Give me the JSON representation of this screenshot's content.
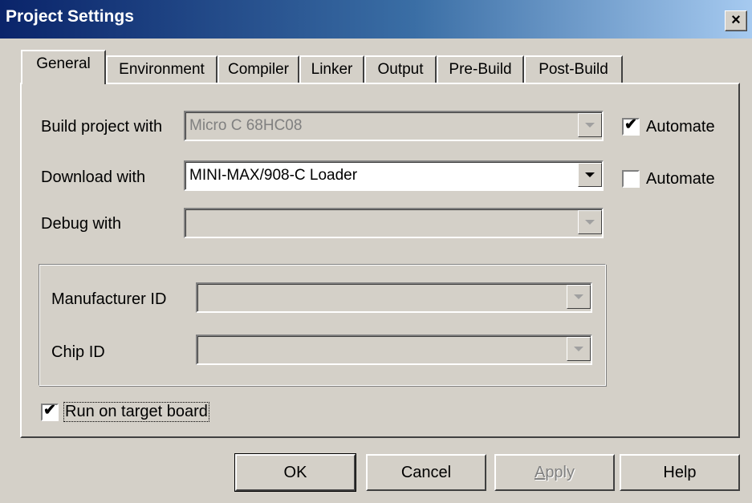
{
  "window": {
    "title": "Project Settings",
    "close_glyph": "×"
  },
  "tabs": [
    {
      "label": "General",
      "active": true
    },
    {
      "label": "Environment",
      "active": false
    },
    {
      "label": "Compiler",
      "active": false
    },
    {
      "label": "Linker",
      "active": false
    },
    {
      "label": "Output",
      "active": false
    },
    {
      "label": "Pre-Build",
      "active": false
    },
    {
      "label": "Post-Build",
      "active": false
    }
  ],
  "general": {
    "build": {
      "label": "Build project with",
      "value": "Micro C 68HC08",
      "enabled": false,
      "automate_label": "Automate",
      "automate_checked": true
    },
    "download": {
      "label": "Download with",
      "value": "MINI-MAX/908-C Loader",
      "enabled": true,
      "automate_label": "Automate",
      "automate_checked": false
    },
    "debug": {
      "label": "Debug with",
      "value": "",
      "enabled": false
    },
    "manufacturer": {
      "label": "Manufacturer ID",
      "value": "",
      "enabled": false
    },
    "chip": {
      "label": "Chip ID",
      "value": "",
      "enabled": false
    },
    "run_on_target": {
      "label": "Run on target board",
      "checked": true
    }
  },
  "buttons": {
    "ok": "OK",
    "cancel": "Cancel",
    "apply_first": "A",
    "apply_rest": "pply",
    "help": "Help"
  },
  "colors": {
    "face": "#d4d0c8",
    "title_start": "#0a246a",
    "title_end": "#a6caf0"
  },
  "icons": {
    "check": "✔",
    "dropdown": "chevron-down-icon"
  }
}
